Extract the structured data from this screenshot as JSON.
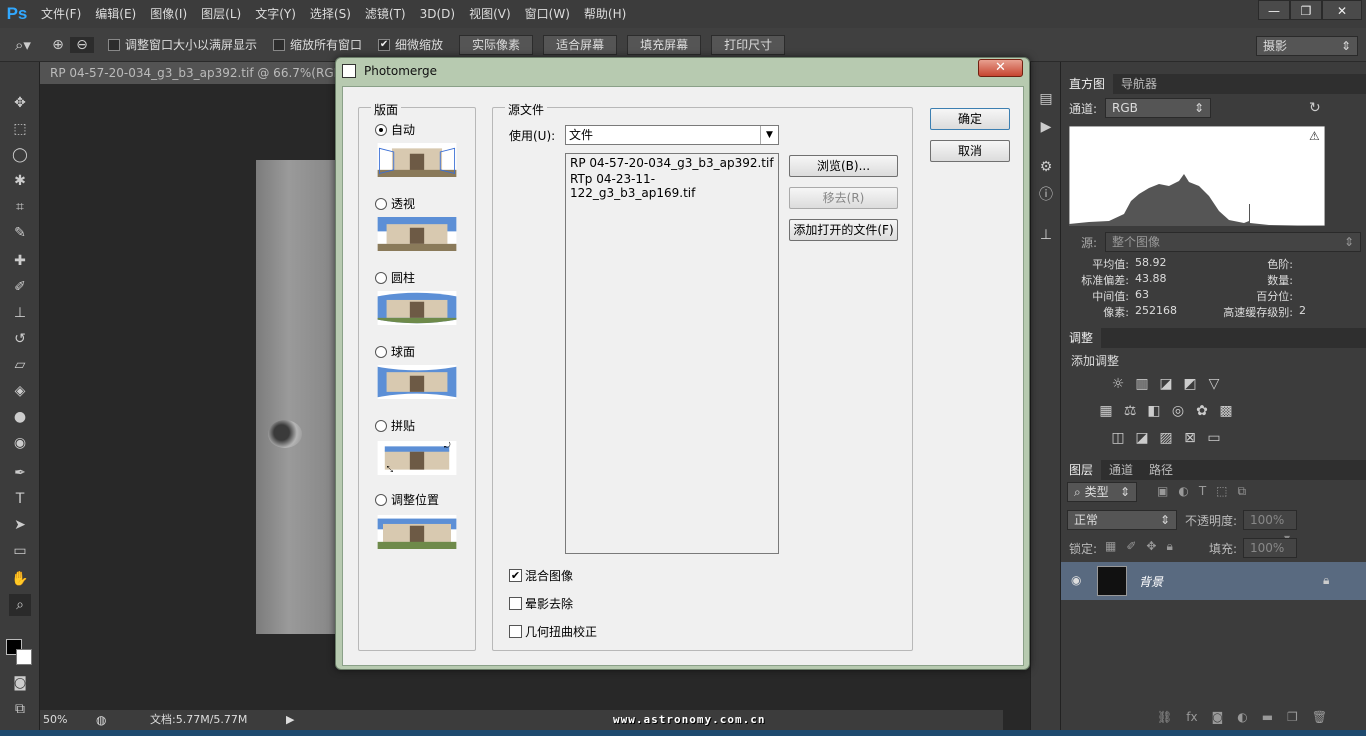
{
  "app": {
    "logo": "Ps"
  },
  "menu": [
    "文件(F)",
    "编辑(E)",
    "图像(I)",
    "图层(L)",
    "文字(Y)",
    "选择(S)",
    "滤镜(T)",
    "3D(D)",
    "视图(V)",
    "窗口(W)",
    "帮助(H)"
  ],
  "window_controls": {
    "minimize": "—",
    "restore": "❐",
    "close": "✕"
  },
  "options": {
    "resize_windows": "调整窗口大小以满屏显示",
    "zoom_all": "缩放所有窗口",
    "scrubby_zoom": "细微缩放",
    "actual_pixels": "实际像素",
    "fit_screen": "适合屏幕",
    "fill_screen": "填充屏幕",
    "print_size": "打印尺寸",
    "workspace": "摄影"
  },
  "document": {
    "tab_title": "RP 04-57-20-034_g3_b3_ap392.tif @ 66.7%(RGB/16",
    "zoom": "50%",
    "doc_size": "文档:5.77M/5.77M"
  },
  "watermark": "www.astronomy.com.cn",
  "histogram": {
    "tabs": [
      "直方图",
      "导航器"
    ],
    "channel_label": "通道:",
    "channel_value": "RGB",
    "source_label": "源:",
    "source_value": "整个图像",
    "stats": {
      "mean_label": "平均值:",
      "mean": "58.92",
      "std_label": "标准偏差:",
      "std": "43.88",
      "median_label": "中间值:",
      "median": "63",
      "pixels_label": "像素:",
      "pixels": "252168",
      "level_label": "色阶:",
      "count_label": "数量:",
      "percentile_label": "百分位:",
      "cache_label": "高速缓存级别:",
      "cache": "2"
    }
  },
  "adjustments": {
    "tab": "调整",
    "title": "添加调整"
  },
  "layers": {
    "tabs": [
      "图层",
      "通道",
      "路径"
    ],
    "filter_type": "类型",
    "blend_mode": "正常",
    "opacity_label": "不透明度:",
    "opacity": "100%",
    "lock_label": "锁定:",
    "fill_label": "填充:",
    "fill": "100%",
    "layer_name": "背景"
  },
  "dialog": {
    "title": "Photomerge",
    "close": "✕",
    "layout_group": "版面",
    "layouts": [
      "自动",
      "透视",
      "圆柱",
      "球面",
      "拼贴",
      "调整位置"
    ],
    "selected_layout": "自动",
    "source_group": "源文件",
    "use_label": "使用(U):",
    "use_value": "文件",
    "files": [
      "RP 04-57-20-034_g3_b3_ap392.tif",
      "RTp 04-23-11-122_g3_b3_ap169.tif"
    ],
    "browse": "浏览(B)...",
    "remove": "移去(R)",
    "add_open": "添加打开的文件(F)",
    "ok": "确定",
    "cancel": "取消",
    "options": [
      {
        "label": "混合图像",
        "checked": true
      },
      {
        "label": "晕影去除",
        "checked": false
      },
      {
        "label": "几何扭曲校正",
        "checked": false
      }
    ]
  }
}
